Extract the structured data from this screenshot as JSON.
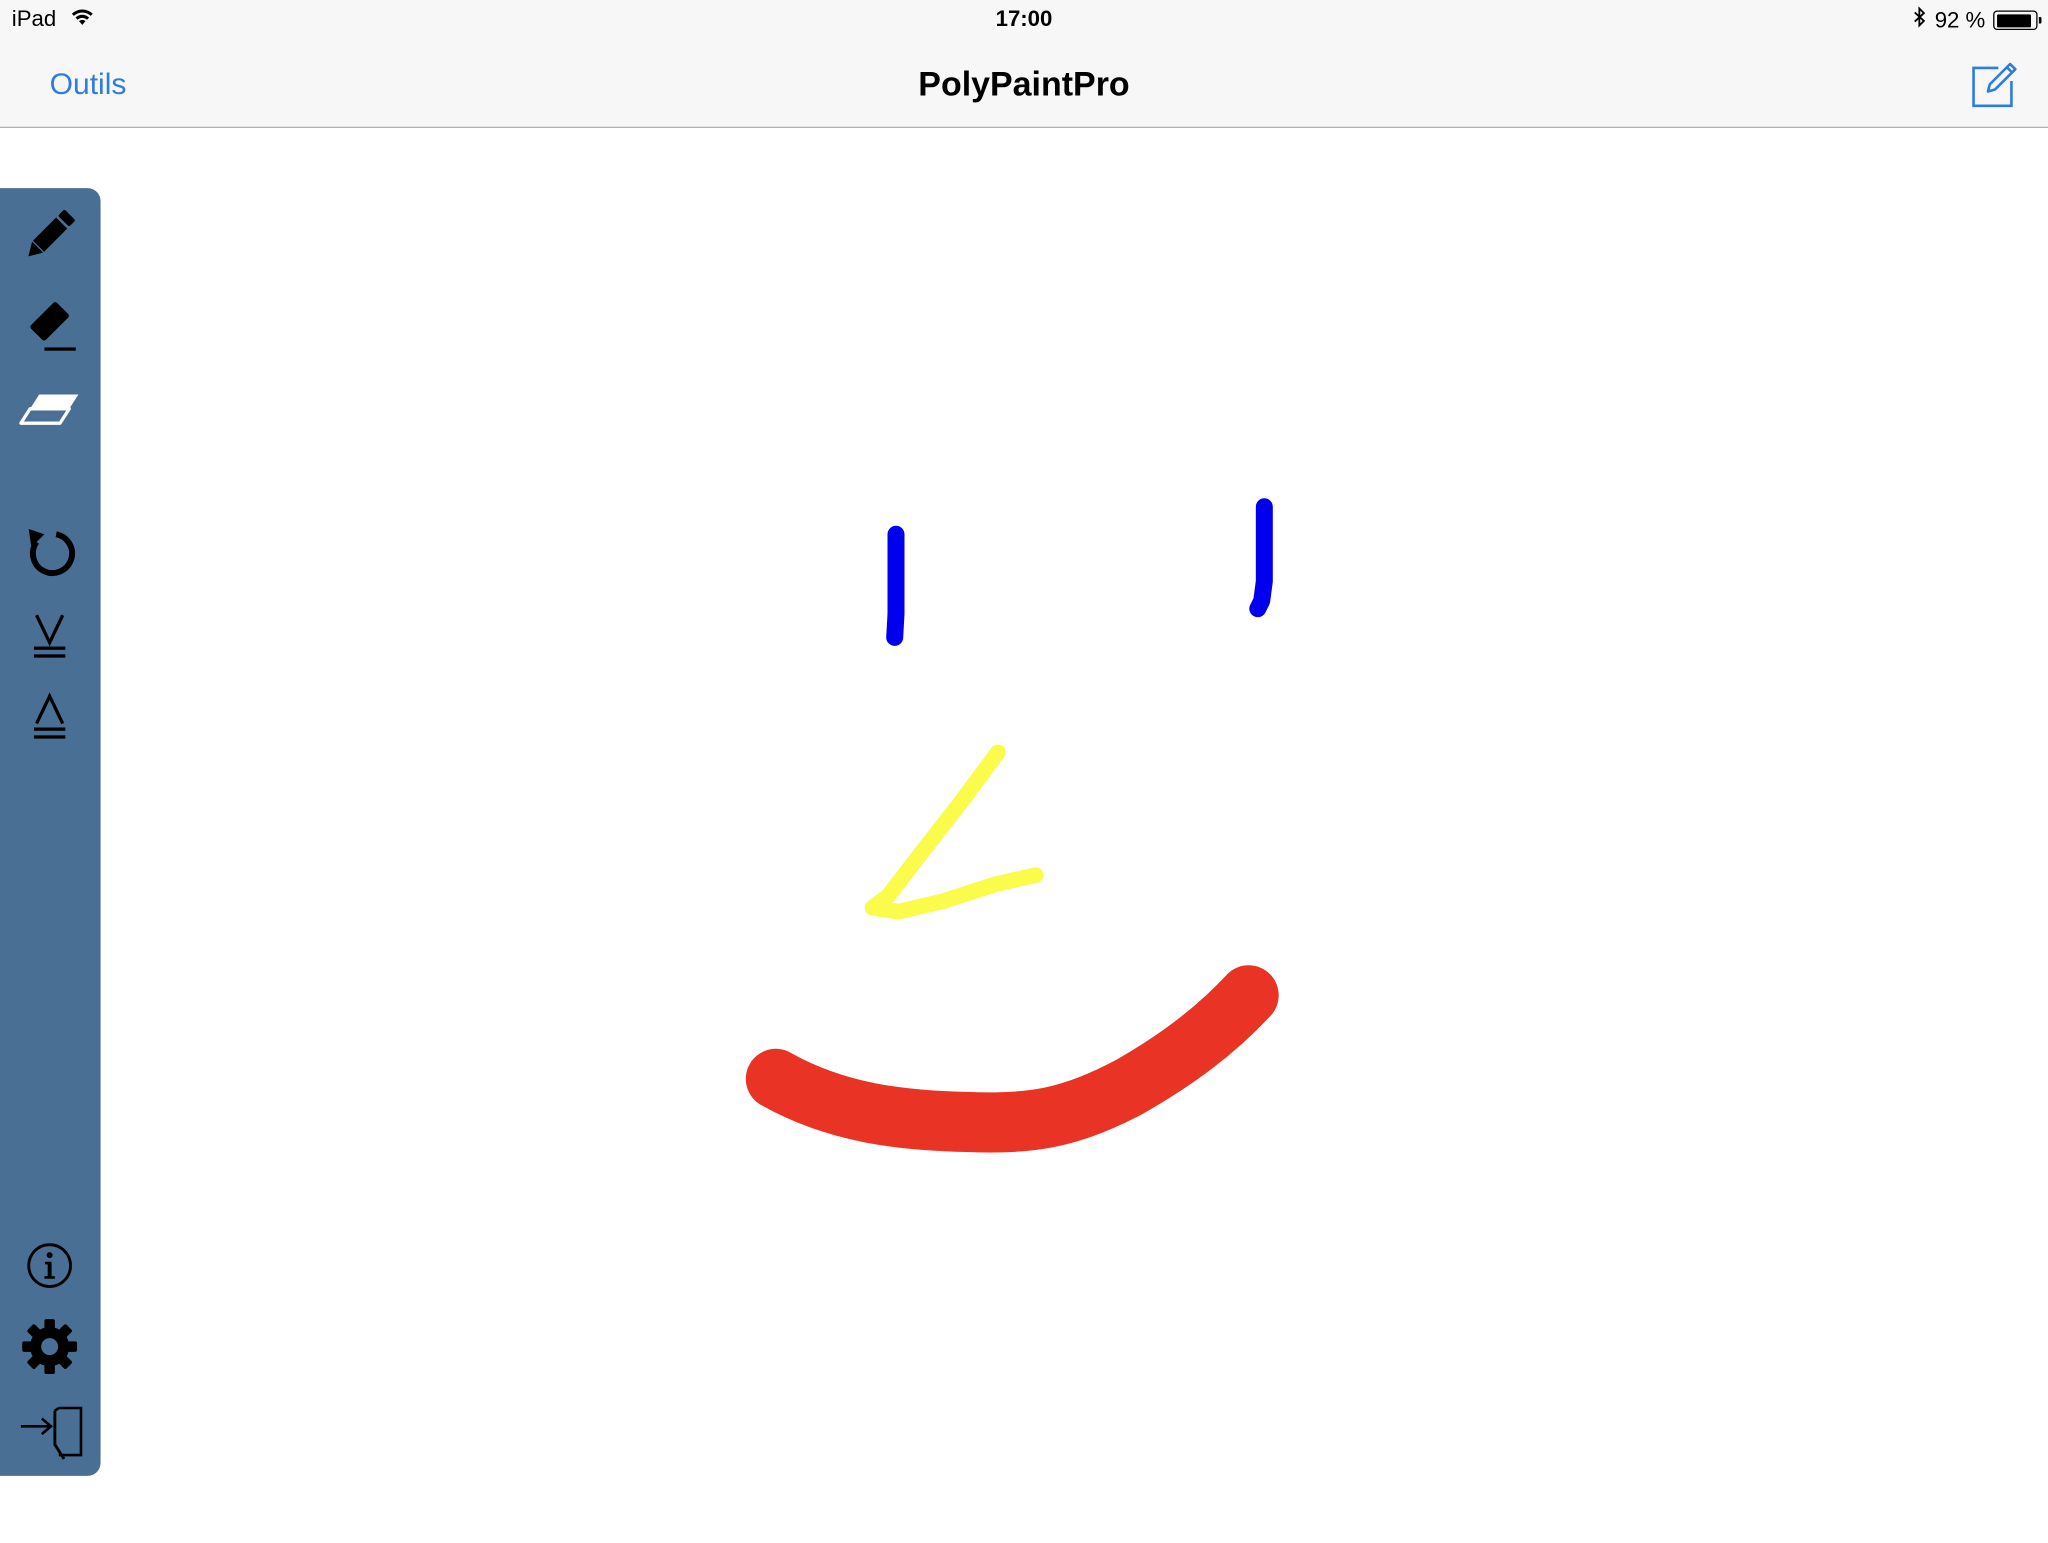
{
  "status_bar": {
    "device": "iPad",
    "time": "17:00",
    "battery_percent": "92 %",
    "battery_level": 0.92,
    "icons": [
      "wifi-icon",
      "bluetooth-icon",
      "battery-icon"
    ]
  },
  "nav": {
    "left_button": "Outils",
    "title": "PolyPaintPro",
    "right_icon": "compose-icon"
  },
  "toolbar": {
    "tools": [
      {
        "name": "pencil-tool",
        "icon": "pencil-icon"
      },
      {
        "name": "stroke-eraser-tool",
        "icon": "stroke-eraser-icon"
      },
      {
        "name": "point-eraser-tool",
        "icon": "eraser-icon"
      },
      {
        "name": "undo-tool",
        "icon": "undo-icon"
      },
      {
        "name": "stack-down-tool",
        "icon": "stack-down-icon"
      },
      {
        "name": "stack-up-tool",
        "icon": "stack-up-icon"
      },
      {
        "name": "info-tool",
        "icon": "info-icon"
      },
      {
        "name": "settings-tool",
        "icon": "gear-icon"
      },
      {
        "name": "exit-tool",
        "icon": "exit-icon"
      }
    ],
    "background_color": "#4a6f94"
  },
  "canvas": {
    "strokes": [
      {
        "name": "left-eye-stroke",
        "color": "#0000ee"
      },
      {
        "name": "right-eye-stroke",
        "color": "#0000ee"
      },
      {
        "name": "nose-stroke",
        "color": "#fbfb4b"
      },
      {
        "name": "mouth-stroke",
        "color": "#e83325"
      }
    ]
  },
  "colors": {
    "accent": "#2f7ce0",
    "toolbar": "#4a6f94"
  }
}
